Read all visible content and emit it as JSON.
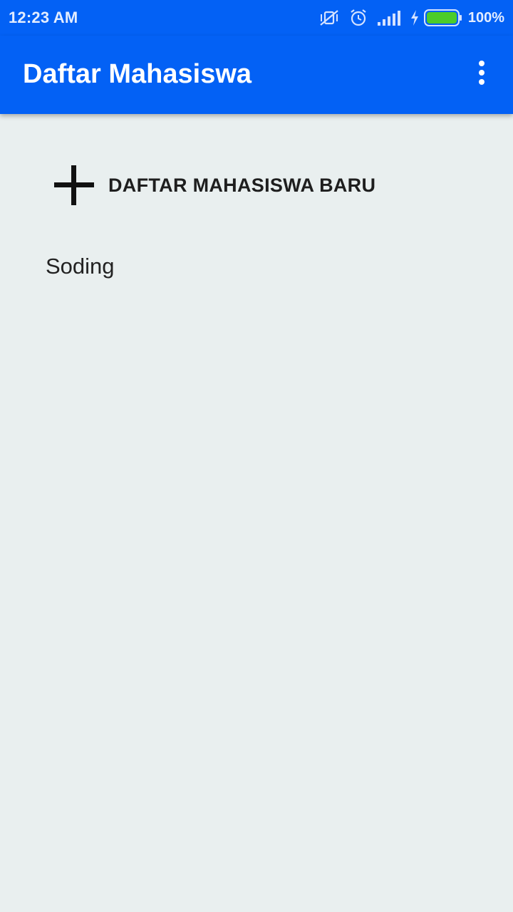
{
  "status_bar": {
    "time": "12:23 AM",
    "icons": [
      "vibrate-off-icon",
      "alarm-icon",
      "signal-icon",
      "charging-icon",
      "battery-icon"
    ],
    "battery_percent": "100%",
    "battery_color": "#4ccc2a"
  },
  "app_bar": {
    "title": "Daftar Mahasiswa",
    "menu_icon": "more-vert-icon",
    "color": "#0361f5"
  },
  "main": {
    "add_button": {
      "icon": "plus-icon",
      "label": "DAFTAR MAHASISWA BARU"
    },
    "students": [
      {
        "name": "Soding"
      }
    ]
  },
  "colors": {
    "background": "#e9efef",
    "primary": "#0361f5"
  }
}
